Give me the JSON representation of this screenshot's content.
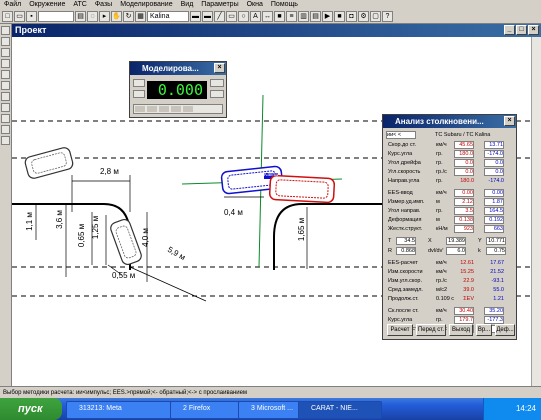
{
  "menu": [
    "Файл",
    "Окружение",
    "АТС",
    "Фазы",
    "Моделирование",
    "Вид",
    "Параметры",
    "Окна",
    "Помощь"
  ],
  "toolbar": {
    "vehicle_select": "Kalina"
  },
  "project_title": "Проект",
  "sim_window": {
    "title": "Моделирова...",
    "display": "0.000"
  },
  "drawing": {
    "dim_labels": [
      "2,8 м",
      "3,6 м",
      "0,65 м",
      "1,25 м",
      "1,1 м",
      "4,0 м",
      "0,55 м",
      "5,9 м",
      "0,4 м",
      "1,65 м"
    ],
    "vehicle_label": "Kalina"
  },
  "analysis": {
    "title": "Анализ столкновени...",
    "header_select": "ии< <",
    "header_ts": "ТС Subaru / ТС Kalina",
    "rows": [
      {
        "label": "Скор.до ст.",
        "unit": "км/ч",
        "v1": "45.65",
        "v2": "13.71",
        "boxed": true
      },
      {
        "label": "Курс.угла",
        "unit": "гр.",
        "v1": "180.0",
        "v2": "-174.0",
        "boxed": true
      },
      {
        "label": "Угол дрейфа",
        "unit": "гр.",
        "v1": "0.0",
        "v2": "0.0",
        "boxed": true
      },
      {
        "label": "Угл.скорость",
        "unit": "гр./с",
        "v1": "0.0",
        "v2": "0.0",
        "boxed": true
      },
      {
        "label": "Направ.угла",
        "unit": "гр.",
        "v1": "180.0",
        "v2": "-174.0",
        "boxed": false
      },
      {
        "label": "EES-ввод",
        "unit": "км/ч",
        "v1": "0.00",
        "v2": "0.00",
        "boxed": true
      },
      {
        "label": "Измер.уд.имп.",
        "unit": "м",
        "v1": "2.12",
        "v2": "1.87",
        "boxed": true
      },
      {
        "label": "Угол направ.",
        "unit": "гр.",
        "v1": "3.5",
        "v2": "164.5",
        "boxed": true
      },
      {
        "label": "Деформация",
        "unit": "м",
        "v1": "0.138",
        "v2": "0.192",
        "boxed": true
      },
      {
        "label": "Жестк.структ.",
        "unit": "кН/м",
        "v1": "923",
        "v2": "663",
        "boxed": true
      }
    ],
    "params": [
      {
        "l1": "T",
        "v1": "34.5",
        "l2": "Х",
        "v2": "19.389",
        "l3": "Y",
        "v3": "10.771"
      },
      {
        "l1": "R",
        "v1": "0.868",
        "l2": "dvl/dv'",
        "v2": "6.0",
        "l3": "k",
        "v3": "0.75"
      }
    ],
    "results": [
      {
        "label": "EES-расчет",
        "unit": "км/ч",
        "v1": "12.61",
        "v2": "17.67"
      },
      {
        "label": "Изм.скорости",
        "unit": "км/ч",
        "v1": "15.25",
        "v2": "21.52"
      },
      {
        "label": "Изм.угл.скор.",
        "unit": "гр./с",
        "v1": "22.9",
        "v2": "-93.1"
      },
      {
        "label": "Сред.замедл.",
        "unit": "м/с2",
        "v1": "39.0",
        "v2": "55.0"
      },
      {
        "label": "Продолж.ст.",
        "unit": "0.109 с",
        "v1": "ΣEV",
        "v2": "1.21"
      }
    ],
    "after": [
      {
        "label": "Ск.после ст.",
        "unit": "км/ч",
        "v1": "30.40",
        "v2": "35.20"
      },
      {
        "label": "Курс.угла",
        "unit": "гр.",
        "v1": "179.7",
        "v2": "-177.3"
      },
      {
        "label": "Угл.скорость",
        "unit": "гр./с",
        "v1": "-26",
        "v2": "95"
      }
    ],
    "buttons": [
      "Расчет",
      "Перед ст.",
      "Выход",
      "Вр...",
      "Деф..."
    ]
  },
  "status_text": "Выбор методики расчета: ии<импульс; EES.>прямой;<- обратный;<-> с прослаиванием",
  "taskbar": {
    "start": "пуск",
    "tasks": [
      "313213: Meta",
      "2 Firefox",
      "3 Microsoft ...",
      "CARAT - NIE..."
    ],
    "clock": "14:24"
  },
  "colors": {
    "car_red": "#d01010",
    "car_blue": "#1010d0",
    "title_blue": "#0a246a",
    "axis_green": "#0a8a2a"
  }
}
